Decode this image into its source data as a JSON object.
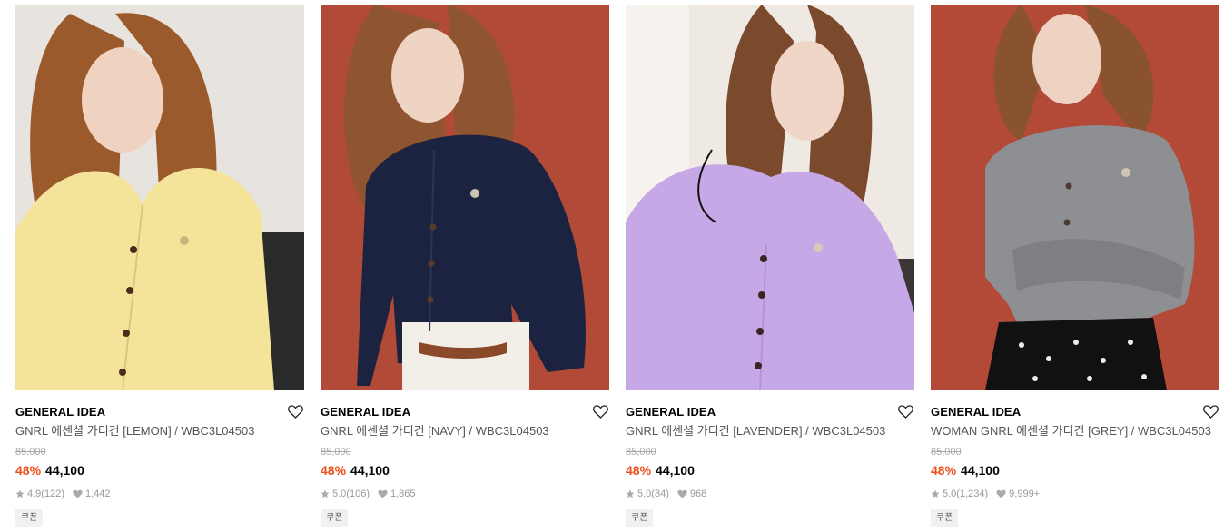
{
  "products": [
    {
      "brand": "GENERAL IDEA",
      "title": "GNRL 에센셜 가디건 [LEMON] / WBC3L04503",
      "original_price": "85,000",
      "discount": "48%",
      "price": "44,100",
      "rating": "4.9",
      "review_count": "(122)",
      "likes": "1,442",
      "coupon": "쿠폰",
      "colors": {
        "bg_top": "#e7e4df",
        "bg_bottom": "#2b2a2a",
        "garment": "#f4e49a",
        "hair": "#9b5a2c"
      }
    },
    {
      "brand": "GENERAL IDEA",
      "title": "GNRL 에센셜 가디건 [NAVY] / WBC3L04503",
      "original_price": "85,000",
      "discount": "48%",
      "price": "44,100",
      "rating": "5.0",
      "review_count": "(106)",
      "likes": "1,865",
      "coupon": "쿠폰",
      "colors": {
        "bg_top": "#b24a38",
        "bg_bottom": "#a8432f",
        "garment": "#1b2340",
        "hair": "#8f5430"
      }
    },
    {
      "brand": "GENERAL IDEA",
      "title": "GNRL 에센셜 가디건 [LAVENDER] / WBC3L04503",
      "original_price": "85,000",
      "discount": "48%",
      "price": "44,100",
      "rating": "5.0",
      "review_count": "(84)",
      "likes": "968",
      "coupon": "쿠폰",
      "colors": {
        "bg_top": "#efe9e3",
        "bg_bottom": "#d8d2cc",
        "garment": "#c7a8e6",
        "hair": "#7b4a2d"
      }
    },
    {
      "brand": "GENERAL IDEA",
      "title": "WOMAN GNRL 에센셜 가디건 [GREY] / WBC3L04503",
      "original_price": "85,000",
      "discount": "48%",
      "price": "44,100",
      "rating": "5.0",
      "review_count": "(1,234)",
      "likes": "9,999+",
      "coupon": "쿠폰",
      "colors": {
        "bg_top": "#b34a38",
        "bg_bottom": "#a7432f",
        "garment": "#8e8f92",
        "hair": "#8a5330"
      }
    }
  ],
  "accent_color": "#ee4e1a"
}
